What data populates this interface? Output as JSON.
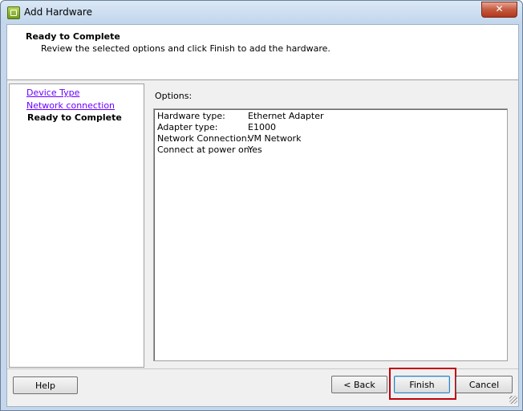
{
  "window": {
    "title": "Add Hardware",
    "close_label": "✕"
  },
  "header": {
    "title": "Ready to Complete",
    "subtitle": "Review the selected options and click Finish to add the hardware."
  },
  "nav": {
    "items": [
      {
        "label": "Device Type"
      },
      {
        "label": "Network connection"
      }
    ],
    "current": "Ready to Complete"
  },
  "options": {
    "label": "Options:",
    "rows": [
      {
        "key": "Hardware type:",
        "value": "Ethernet Adapter"
      },
      {
        "key": "Adapter type:",
        "value": "E1000"
      },
      {
        "key": "Network Connection:",
        "value": "VM Network"
      },
      {
        "key": "Connect at power on:",
        "value": "Yes"
      }
    ]
  },
  "buttons": {
    "help": "Help",
    "back": "< Back",
    "finish": "Finish",
    "cancel": "Cancel"
  },
  "colors": {
    "link": "#6a00ff",
    "highlight": "#c0000a",
    "titlebar": "#c4d7ec"
  }
}
